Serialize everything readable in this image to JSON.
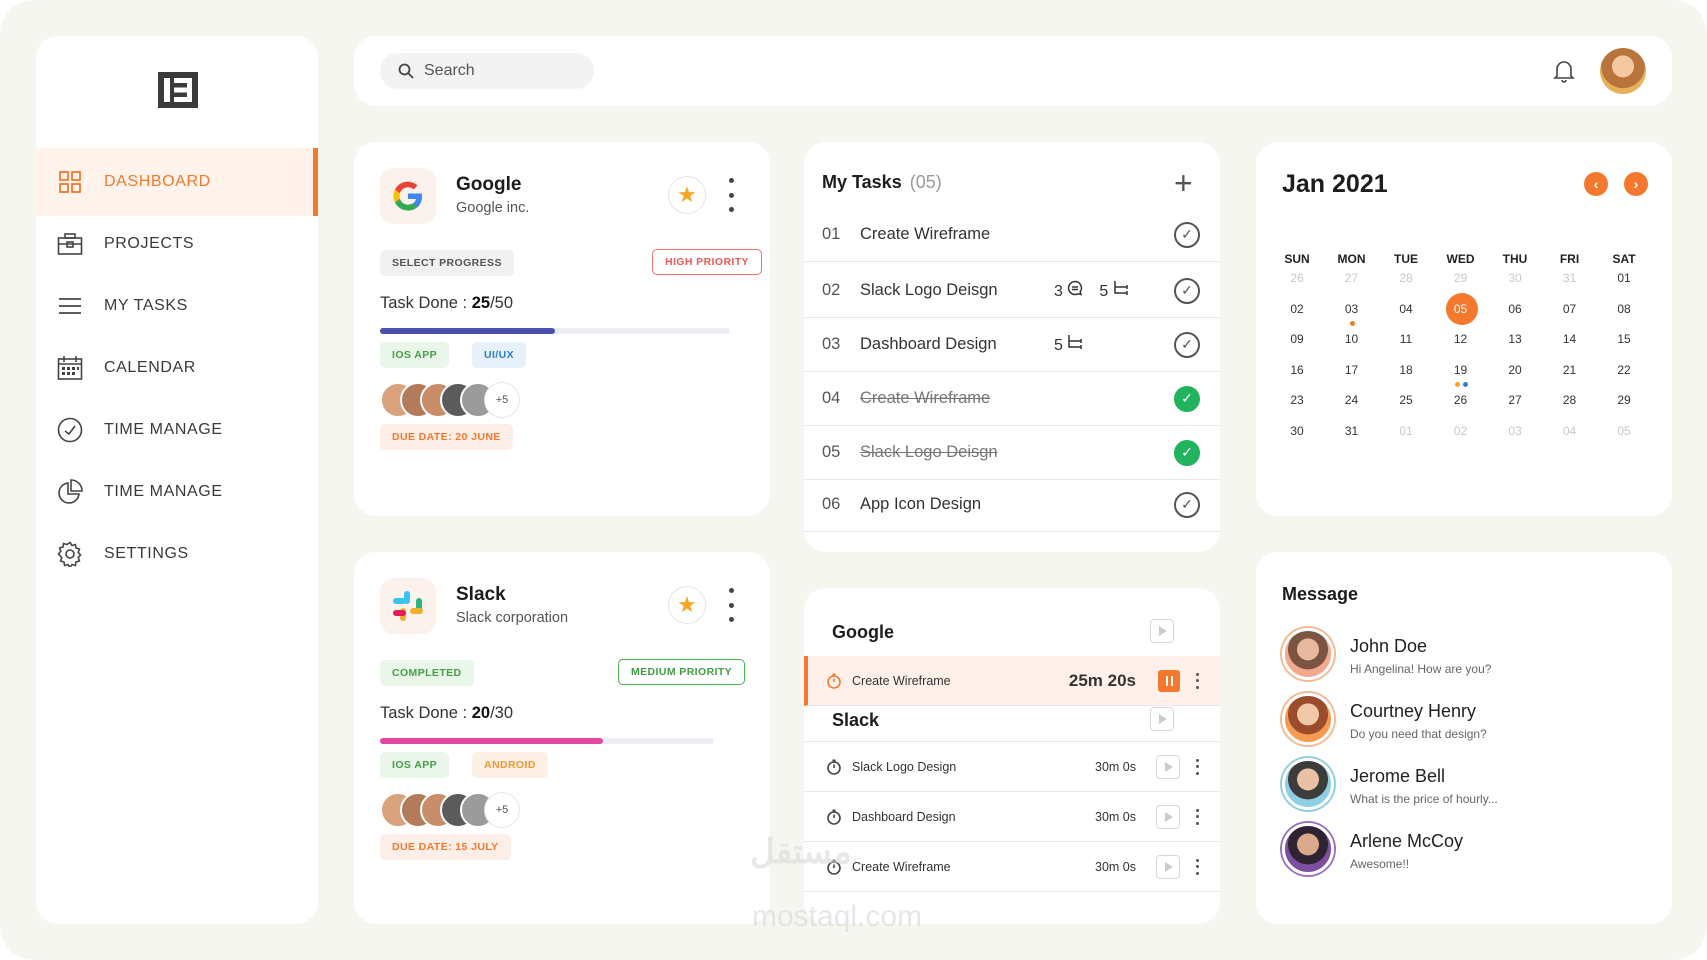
{
  "sidebar": {
    "items": [
      {
        "label": "DASHBOARD",
        "icon": "grid-icon",
        "active": true
      },
      {
        "label": "PROJECTS",
        "icon": "briefcase-icon"
      },
      {
        "label": "MY TASKS",
        "icon": "list-icon"
      },
      {
        "label": "CALENDAR",
        "icon": "calendar-icon"
      },
      {
        "label": "TIME MANAGE",
        "icon": "clock-icon"
      },
      {
        "label": "TIME MANAGE",
        "icon": "pie-chart-icon"
      },
      {
        "label": "SETTINGS",
        "icon": "gear-icon"
      }
    ]
  },
  "topbar": {
    "search_placeholder": "Search"
  },
  "projects": [
    {
      "name": "Google",
      "sub": "Google inc.",
      "status": "SELECT PROGRESS",
      "priority": "HIGH PRIORITY",
      "done_label": "Task Done :",
      "done": "25",
      "total": "/50",
      "progress": 0.5,
      "tags": [
        "IOS APP",
        "UI/UX"
      ],
      "more": "+5",
      "due": "DUE DATE: 20 JUNE",
      "bar_color": "#4b4fae"
    },
    {
      "name": "Slack",
      "sub": "Slack corporation",
      "status": "COMPLETED",
      "priority": "MEDIUM PRIORITY",
      "done_label": "Task Done :",
      "done": "20",
      "total": "/30",
      "progress": 0.6667,
      "tags": [
        "IOS APP",
        "ANDROID"
      ],
      "more": "+5",
      "due": "DUE DATE: 15 JULY",
      "bar_color": "#e0479e"
    }
  ],
  "tasks": {
    "title": "My Tasks",
    "count": "(05)",
    "items": [
      {
        "num": "01",
        "text": "Create Wireframe",
        "done": false
      },
      {
        "num": "02",
        "text": "Slack Logo Deisgn",
        "comments": "3",
        "subtasks": "5",
        "done": false
      },
      {
        "num": "03",
        "text": "Dashboard Design",
        "subtasks": "5",
        "done": false
      },
      {
        "num": "04",
        "text": "Create Wireframe",
        "done": true
      },
      {
        "num": "05",
        "text": "Slack Logo Deisgn",
        "done": true
      },
      {
        "num": "06",
        "text": "App Icon Design",
        "done": false
      }
    ]
  },
  "timer": {
    "groups": [
      {
        "name": "Google"
      },
      {
        "name": "Slack"
      }
    ],
    "active": {
      "name": "Create Wireframe",
      "time": "25m 20s"
    },
    "rows": [
      {
        "name": "Slack Logo Design",
        "time": "30m 0s"
      },
      {
        "name": "Dashboard Design",
        "time": "30m 0s"
      },
      {
        "name": "Create Wireframe",
        "time": "30m 0s"
      }
    ]
  },
  "calendar": {
    "title": "Jan 2021",
    "dow": [
      "SUN",
      "MON",
      "TUE",
      "WED",
      "THU",
      "FRI",
      "SAT"
    ],
    "weeks": [
      [
        "26",
        "27",
        "28",
        "29",
        "30",
        "31",
        "01"
      ],
      [
        "02",
        "03",
        "04",
        "05",
        "06",
        "07",
        "08"
      ],
      [
        "09",
        "10",
        "11",
        "12",
        "13",
        "14",
        "15"
      ],
      [
        "16",
        "17",
        "18",
        "19",
        "20",
        "21",
        "22"
      ],
      [
        "23",
        "24",
        "25",
        "26",
        "27",
        "28",
        "29"
      ],
      [
        "30",
        "31",
        "01",
        "02",
        "03",
        "04",
        "05"
      ]
    ],
    "selected": "05"
  },
  "messages": {
    "title": "Message",
    "items": [
      {
        "name": "John Doe",
        "text": "Hi Angelina! How are you?"
      },
      {
        "name": "Courtney Henry",
        "text": "Do you need that design?"
      },
      {
        "name": "Jerome Bell",
        "text": "What is the price of hourly..."
      },
      {
        "name": "Arlene McCoy",
        "text": "Awesome!!"
      }
    ]
  },
  "watermark": {
    "ar": "مستقل",
    "en": "mostaql.com"
  },
  "colors": {
    "accent": "#f4792e",
    "success": "#21b35e"
  }
}
